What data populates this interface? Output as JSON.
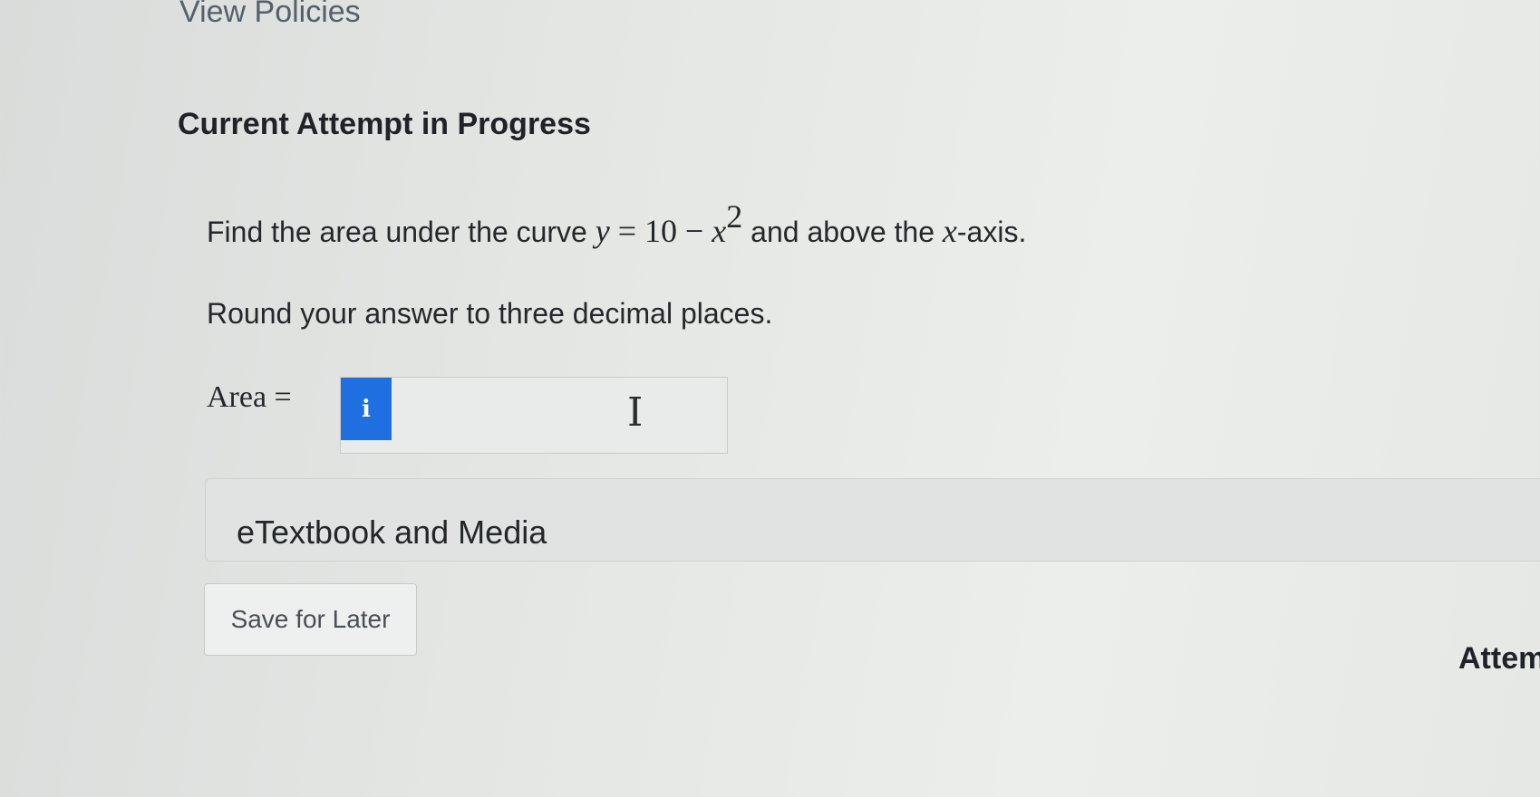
{
  "header": {
    "view_policies": "View Policies",
    "attempt_title": "Current Attempt in Progress"
  },
  "question": {
    "prefix": "Find the area under the curve ",
    "eq_y": "y",
    "eq_mid": " = 10 − ",
    "eq_x": "x",
    "eq_exp": "2",
    "suffix_a": " and above the ",
    "axis_var": "x",
    "suffix_b": "-axis.",
    "instruction": "Round your answer to three decimal places."
  },
  "answer": {
    "label": "Area =",
    "info_glyph": "i",
    "value": "",
    "cursor_glyph": "I"
  },
  "etextbook": {
    "label": "eTextbook and Media"
  },
  "actions": {
    "save_label": "Save for Later"
  },
  "footer": {
    "attempts_label": "Attem"
  },
  "icons": {
    "info": "info-icon",
    "cursor": "text-cursor-icon"
  },
  "colors": {
    "info_button": "#1f6fe0"
  }
}
